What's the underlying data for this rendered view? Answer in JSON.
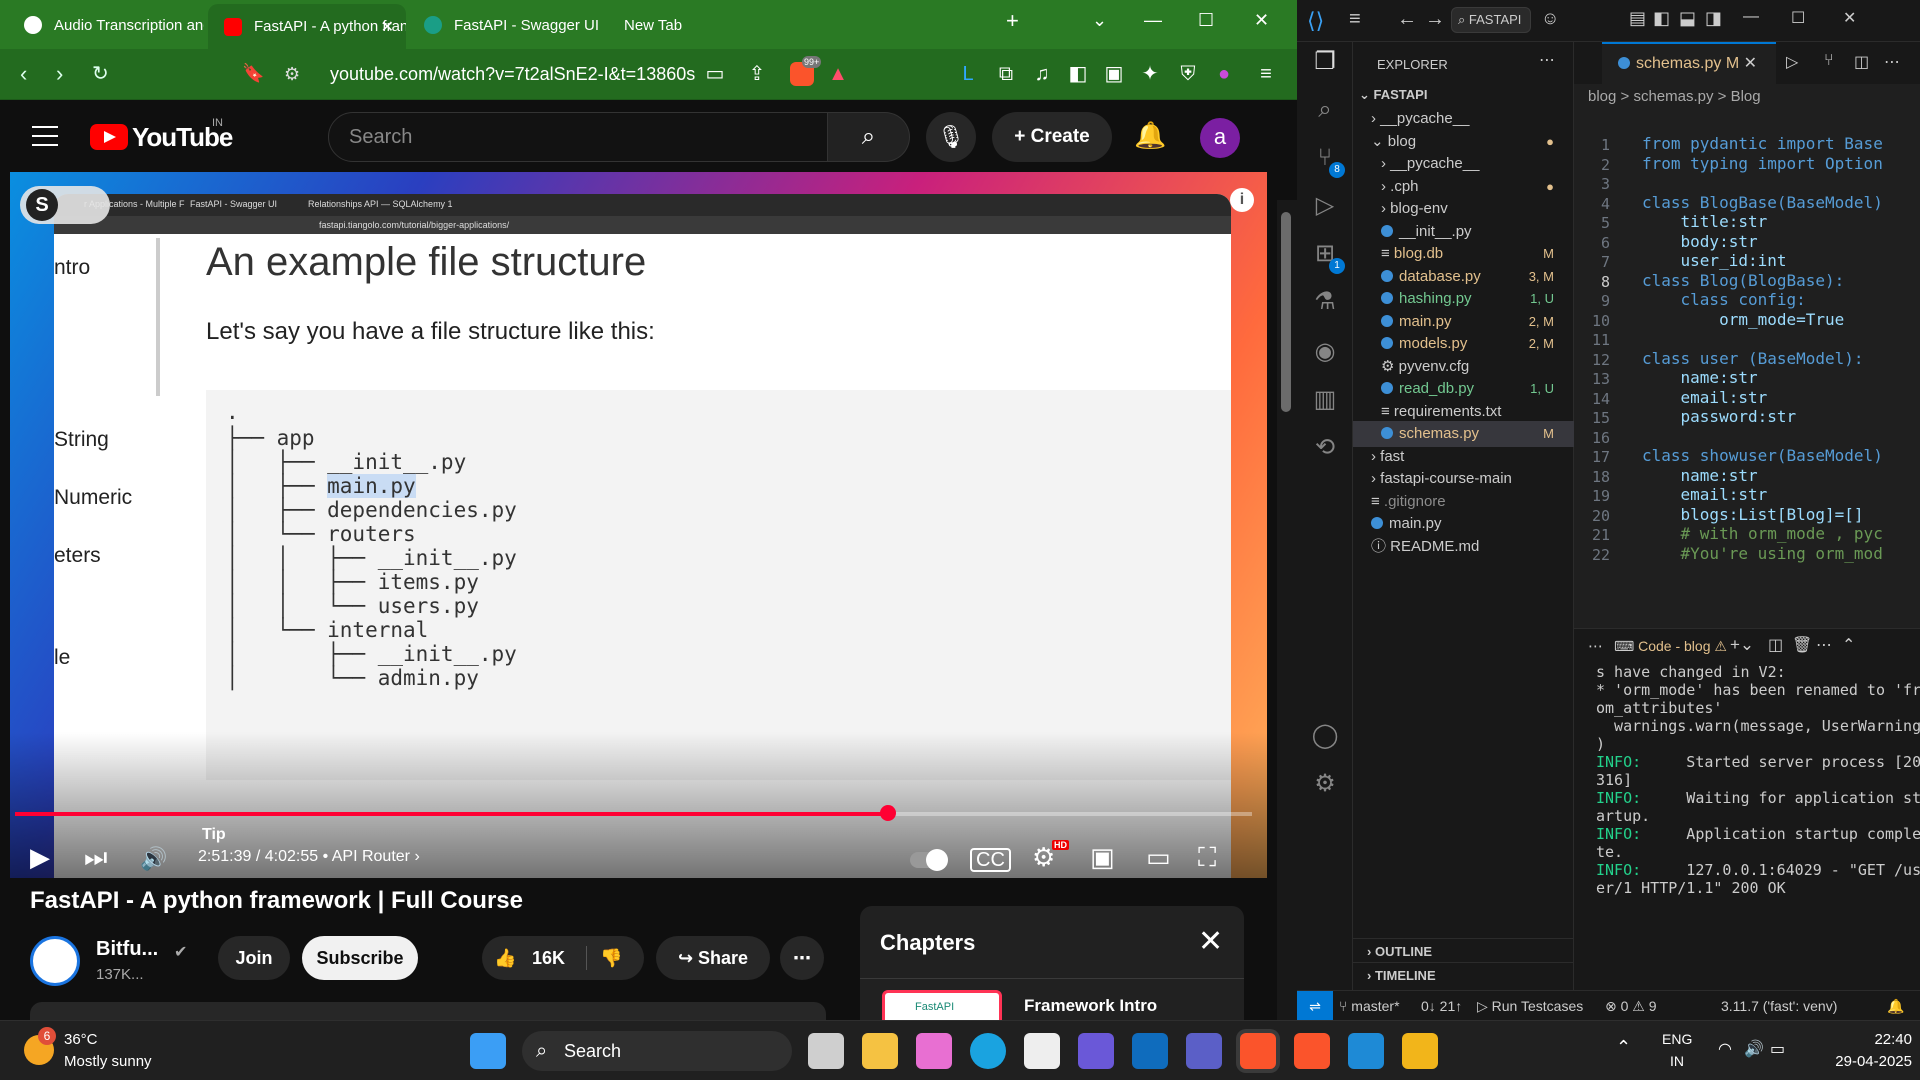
{
  "browser": {
    "tabs": [
      {
        "label": "Audio Transcription and Co",
        "favicon_color": "#ffffff"
      },
      {
        "label": "FastAPI - A python fran",
        "favicon_color": "#ff0000"
      },
      {
        "label": "FastAPI - Swagger UI",
        "favicon_color": "#1a9e86"
      },
      {
        "label": "New Tab",
        "favicon_color": ""
      }
    ],
    "new_tab_icon": "+",
    "tab_list_icon": "chevron-down-icon",
    "url": "youtube.com/watch?v=7t2alSnE2-I&t=13860s",
    "shield_badge": "99+",
    "accent_color": "#2a7a24"
  },
  "youtube": {
    "logo_text": "YouTube",
    "country_code": "IN",
    "search_placeholder": "Search",
    "create_label": "Create",
    "avatar_letter": "a",
    "video": {
      "inner_tabs": [
        "r Applications - Multiple F",
        "FastAPI - Swagger UI",
        "Relationships API — SQLAlchemy 1"
      ],
      "inner_url": "fastapi.tiangolo.com/tutorial/bigger-applications/",
      "sidebar_items": [
        "ntro",
        "String",
        "Numeric",
        "eters",
        "le"
      ],
      "doc_heading": "An example file structure",
      "doc_paragraph": "Let's say you have a file structure like this:",
      "code_lines": [
        ".",
        "├── app",
        "│   ├── __init__.py",
        "│   ├── main.py",
        "│   ├── dependencies.py",
        "│   └── routers",
        "│   │   ├── __init__.py",
        "│   │   ├── items.py",
        "│   │   └── users.py",
        "│   └── internal",
        "│       ├── __init__.py",
        "│       └── admin.py"
      ],
      "highlighted_word": "main.py",
      "current_time": "2:51:39",
      "duration": "4:02:55",
      "chapter_label": "API Router",
      "progress_fraction": 0.706,
      "hd_badge": "HD",
      "tip_text": "Tip",
      "channel_watermark": "S"
    },
    "title": "FastAPI - A python framework | Full Course",
    "channel_name": "Bitfu...",
    "channel_subs": "137K...",
    "join_label": "Join",
    "subscribe_label": "Subscribe",
    "likes": "16K",
    "share_label": "Share",
    "chapters_heading": "Chapters",
    "chapter_item_title": "Framework Intro",
    "chapter_thumb_text": "FastAPI"
  },
  "vscode": {
    "title_search": "FASTAPI",
    "explorer_heading": "EXPLORER",
    "project_name": "FASTAPI",
    "tree": [
      {
        "label": "__pycache__",
        "type": "folder",
        "depth": 1,
        "status": ""
      },
      {
        "label": "blog",
        "type": "folder-open",
        "depth": 1,
        "status": "●"
      },
      {
        "label": "__pycache__",
        "type": "folder",
        "depth": 2,
        "status": ""
      },
      {
        "label": ".cph",
        "type": "folder",
        "depth": 2,
        "status": "●"
      },
      {
        "label": "blog-env",
        "type": "folder",
        "depth": 2,
        "status": ""
      },
      {
        "label": "__init__.py",
        "type": "py",
        "depth": 2,
        "status": ""
      },
      {
        "label": "blog.db",
        "type": "file",
        "depth": 2,
        "status": "M"
      },
      {
        "label": "database.py",
        "type": "py",
        "depth": 2,
        "status": "3, M"
      },
      {
        "label": "hashing.py",
        "type": "py",
        "depth": 2,
        "status": "1, U"
      },
      {
        "label": "main.py",
        "type": "py",
        "depth": 2,
        "status": "2, M"
      },
      {
        "label": "models.py",
        "type": "py",
        "depth": 2,
        "status": "2, M"
      },
      {
        "label": "pyvenv.cfg",
        "type": "gear",
        "depth": 2,
        "status": ""
      },
      {
        "label": "read_db.py",
        "type": "py",
        "depth": 2,
        "status": "1, U"
      },
      {
        "label": "requirements.txt",
        "type": "file",
        "depth": 2,
        "status": ""
      },
      {
        "label": "schemas.py",
        "type": "py",
        "depth": 2,
        "status": "M"
      },
      {
        "label": "fast",
        "type": "folder",
        "depth": 1,
        "status": ""
      },
      {
        "label": "fastapi-course-main",
        "type": "folder",
        "depth": 1,
        "status": ""
      },
      {
        "label": ".gitignore",
        "type": "file",
        "depth": 1,
        "status": ""
      },
      {
        "label": "main.py",
        "type": "py",
        "depth": 1,
        "status": ""
      },
      {
        "label": "README.md",
        "type": "info",
        "depth": 1,
        "status": ""
      }
    ],
    "editor_tab": "schemas.py",
    "editor_tab_status": "M",
    "breadcrumb": "blog > schemas.py > Blog",
    "code": [
      {
        "n": "1",
        "t": "from pydantic import Base"
      },
      {
        "n": "2",
        "t": "from typing import Option"
      },
      {
        "n": "3",
        "t": ""
      },
      {
        "n": "4",
        "t": "class BlogBase(BaseModel)"
      },
      {
        "n": "5",
        "t": "    title:str"
      },
      {
        "n": "6",
        "t": "    body:str"
      },
      {
        "n": "7",
        "t": "    user_id:int"
      },
      {
        "n": "8",
        "t": "class Blog(BlogBase):"
      },
      {
        "n": "9",
        "t": "    class config:"
      },
      {
        "n": "10",
        "t": "        orm_mode=True"
      },
      {
        "n": "11",
        "t": ""
      },
      {
        "n": "12",
        "t": "class user (BaseModel):"
      },
      {
        "n": "13",
        "t": "    name:str"
      },
      {
        "n": "14",
        "t": "    email:str"
      },
      {
        "n": "15",
        "t": "    password:str"
      },
      {
        "n": "16",
        "t": ""
      },
      {
        "n": "17",
        "t": "class showuser(BaseModel)"
      },
      {
        "n": "18",
        "t": "    name:str"
      },
      {
        "n": "19",
        "t": "    email:str"
      },
      {
        "n": "20",
        "t": "    blogs:List[Blog]=[]"
      },
      {
        "n": "21",
        "t": "    # with orm_mode , pyc"
      },
      {
        "n": "22",
        "t": "    #You're using orm_mod"
      }
    ],
    "terminal_tab": "Code - blog",
    "terminal": [
      "s have changed in V2:",
      "* 'orm_mode' has been renamed to 'fr",
      "om_attributes'",
      "  warnings.warn(message, UserWarning",
      ")",
      "INFO:     Started server process [20",
      "316]",
      "INFO:     Waiting for application st",
      "artup.",
      "INFO:     Application startup comple",
      "te.",
      "INFO:     127.0.0.1:64029 - \"GET /us",
      "er/1 HTTP/1.1\" 200 OK"
    ],
    "outline_label": "OUTLINE",
    "timeline_label": "TIMELINE",
    "status": {
      "branch": "master*",
      "sync": "0↓ 21↑",
      "run": "Run Testcases",
      "problems": "0",
      "warnings": "9",
      "python": "3.11.7 ('fast': venv)"
    },
    "badges": {
      "source_control": "8",
      "extensions": "1"
    }
  },
  "taskbar": {
    "temperature": "36°C",
    "weather": "Mostly sunny",
    "weather_badge": "6",
    "search_label": "Search",
    "language": "ENG",
    "region": "IN",
    "time": "22:40",
    "date": "29-04-2025"
  }
}
